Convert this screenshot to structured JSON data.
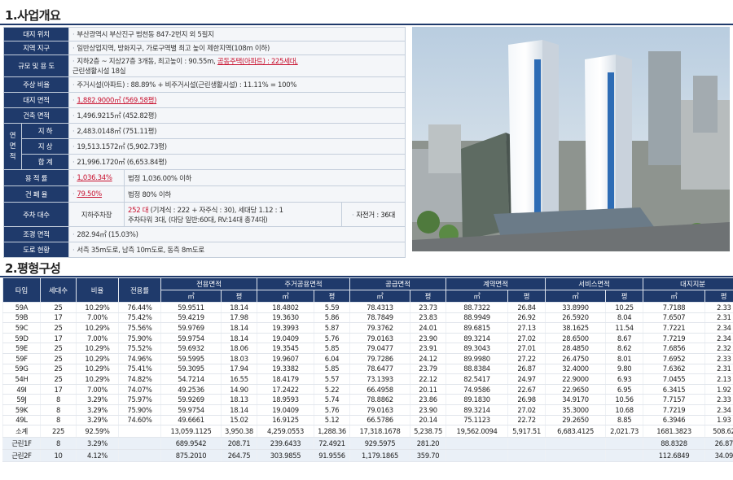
{
  "section1": {
    "title": "1.사업개요",
    "site_location": {
      "label": "대지 위치",
      "value": "부산광역시 부산진구 범천동 847-2번지 외 5필지"
    },
    "zoning": {
      "label": "지역 지구",
      "value": "일반상업지역, 방화지구, 가로구역별 최고 높이 제한지역(108m 이하)"
    },
    "scale_use": {
      "label": "규모 및 용 도",
      "value_a": "지하2층 ~ 지상27층 3개동, 최고높이 : 90.55m, ",
      "value_red": "공동주택(아파트) : 225세대,",
      "value_b": "근린생활시설 18실"
    },
    "housing_ratio": {
      "label": "주상 비율",
      "value": "주거시설(아파트) : 88.89% + 비주거시설(근린생활시설) : 11.11% = 100%"
    },
    "site_area": {
      "label": "대지 면적",
      "value": "1,882.9000㎡ (569.58평)"
    },
    "building_area": {
      "label": "건축 면적",
      "value": "1,496.9215㎡ (452.82평)"
    },
    "floor_area": {
      "label": "연면적",
      "rows": [
        {
          "label": "지 하",
          "value": "2,483.0148㎡ (751.11평)"
        },
        {
          "label": "지 상",
          "value": "19,513.1572㎡ (5,902.73평)"
        },
        {
          "label": "합 계",
          "value": "21,996.1720㎡ (6,653.84평)"
        }
      ]
    },
    "far": {
      "label": "용 적 률",
      "value": "1,036.34%",
      "note": "법정 1,036.00% 이하"
    },
    "bcr": {
      "label": "건 폐 율",
      "value": "79.50%",
      "note": "법정 80% 이하"
    },
    "parking": {
      "label": "주차 대수",
      "sub": "지하주차장",
      "value_red": "252 대",
      "value_a": " (기계식 : 222 + 자주식 : 30), 세대당 1.12 : 1",
      "value_b": "주차타워 3대, (대당 일반:60대, RV:14대 총74대)",
      "bike": "자전거 : 36대"
    },
    "landscape": {
      "label": "조경 면적",
      "value": "282.94㎡ (15.03%)"
    },
    "road": {
      "label": "도로 현황",
      "value": "서측 35m도로, 남측 10m도로, 동측 8m도로"
    }
  },
  "section2": {
    "title": "2.평형구성",
    "headers": {
      "type": "타입",
      "units": "세대수",
      "ratio": "비율",
      "usage": "전용률",
      "groups": [
        "전용면적",
        "주거공용면적",
        "공급면적",
        "계약면적",
        "서비스면적",
        "대지지분"
      ],
      "sqm": "㎡",
      "py": "평"
    },
    "rows": [
      [
        "59A",
        "25",
        "10.29%",
        "76.44%",
        "59.9511",
        "18.14",
        "18.4802",
        "5.59",
        "78.4313",
        "23.73",
        "88.7322",
        "26.84",
        "33.8990",
        "10.25",
        "7.7188",
        "2.33"
      ],
      [
        "59B",
        "17",
        "7.00%",
        "75.42%",
        "59.4219",
        "17.98",
        "19.3630",
        "5.86",
        "78.7849",
        "23.83",
        "88.9949",
        "26.92",
        "26.5920",
        "8.04",
        "7.6507",
        "2.31"
      ],
      [
        "59C",
        "25",
        "10.29%",
        "75.56%",
        "59.9769",
        "18.14",
        "19.3993",
        "5.87",
        "79.3762",
        "24.01",
        "89.6815",
        "27.13",
        "38.1625",
        "11.54",
        "7.7221",
        "2.34"
      ],
      [
        "59D",
        "17",
        "7.00%",
        "75.90%",
        "59.9754",
        "18.14",
        "19.0409",
        "5.76",
        "79.0163",
        "23.90",
        "89.3214",
        "27.02",
        "28.6500",
        "8.67",
        "7.7219",
        "2.34"
      ],
      [
        "59E",
        "25",
        "10.29%",
        "75.52%",
        "59.6932",
        "18.06",
        "19.3545",
        "5.85",
        "79.0477",
        "23.91",
        "89.3043",
        "27.01",
        "28.4850",
        "8.62",
        "7.6856",
        "2.32"
      ],
      [
        "59F",
        "25",
        "10.29%",
        "74.96%",
        "59.5995",
        "18.03",
        "19.9607",
        "6.04",
        "79.7286",
        "24.12",
        "89.9980",
        "27.22",
        "26.4750",
        "8.01",
        "7.6952",
        "2.33"
      ],
      [
        "59G",
        "25",
        "10.29%",
        "75.41%",
        "59.3095",
        "17.94",
        "19.3382",
        "5.85",
        "78.6477",
        "23.79",
        "88.8384",
        "26.87",
        "32.4000",
        "9.80",
        "7.6362",
        "2.31"
      ],
      [
        "54H",
        "25",
        "10.29%",
        "74.82%",
        "54.7214",
        "16.55",
        "18.4179",
        "5.57",
        "73.1393",
        "22.12",
        "82.5417",
        "24.97",
        "22.9000",
        "6.93",
        "7.0455",
        "2.13"
      ],
      [
        "49I",
        "17",
        "7.00%",
        "74.07%",
        "49.2536",
        "14.90",
        "17.2422",
        "5.22",
        "66.4958",
        "20.11",
        "74.9586",
        "22.67",
        "22.9650",
        "6.95",
        "6.3415",
        "1.92"
      ],
      [
        "59J",
        "8",
        "3.29%",
        "75.97%",
        "59.9269",
        "18.13",
        "18.9593",
        "5.74",
        "78.8862",
        "23.86",
        "89.1830",
        "26.98",
        "34.9170",
        "10.56",
        "7.7157",
        "2.33"
      ],
      [
        "59K",
        "8",
        "3.29%",
        "75.90%",
        "59.9754",
        "18.14",
        "19.0409",
        "5.76",
        "79.0163",
        "23.90",
        "89.3214",
        "27.02",
        "35.3000",
        "10.68",
        "7.7219",
        "2.34"
      ],
      [
        "49L",
        "8",
        "3.29%",
        "74.60%",
        "49.6661",
        "15.02",
        "16.9125",
        "5.12",
        "66.5786",
        "20.14",
        "75.1123",
        "22.72",
        "29.2650",
        "8.85",
        "6.3946",
        "1.93"
      ]
    ],
    "subtotal": [
      "소계",
      "225",
      "92.59%",
      "",
      "13,059.1125",
      "3,950.38",
      "4,259.0553",
      "1,288.36",
      "17,318.1678",
      "5,238.75",
      "19,562.0094",
      "5,917.51",
      "6,683.4125",
      "2,021.73",
      "1681.3823",
      "508.62"
    ],
    "extra": [
      [
        "근린1F",
        "8",
        "3.29%",
        "",
        "689.9542",
        "208.71",
        "239.6433",
        "72.4921",
        "929.5975",
        "281.20",
        "",
        "",
        "",
        "",
        "88.8328",
        "26.87"
      ],
      [
        "근린2F",
        "10",
        "4.12%",
        "",
        "875.2010",
        "264.75",
        "303.9855",
        "91.9556",
        "1,179.1865",
        "359.70",
        "",
        "",
        "",
        "",
        "112.6849",
        "34.09"
      ]
    ]
  },
  "colors": {
    "header": "#1f3a6b",
    "accent_red": "#c8102e",
    "cell_bg": "#f4f6f9"
  }
}
